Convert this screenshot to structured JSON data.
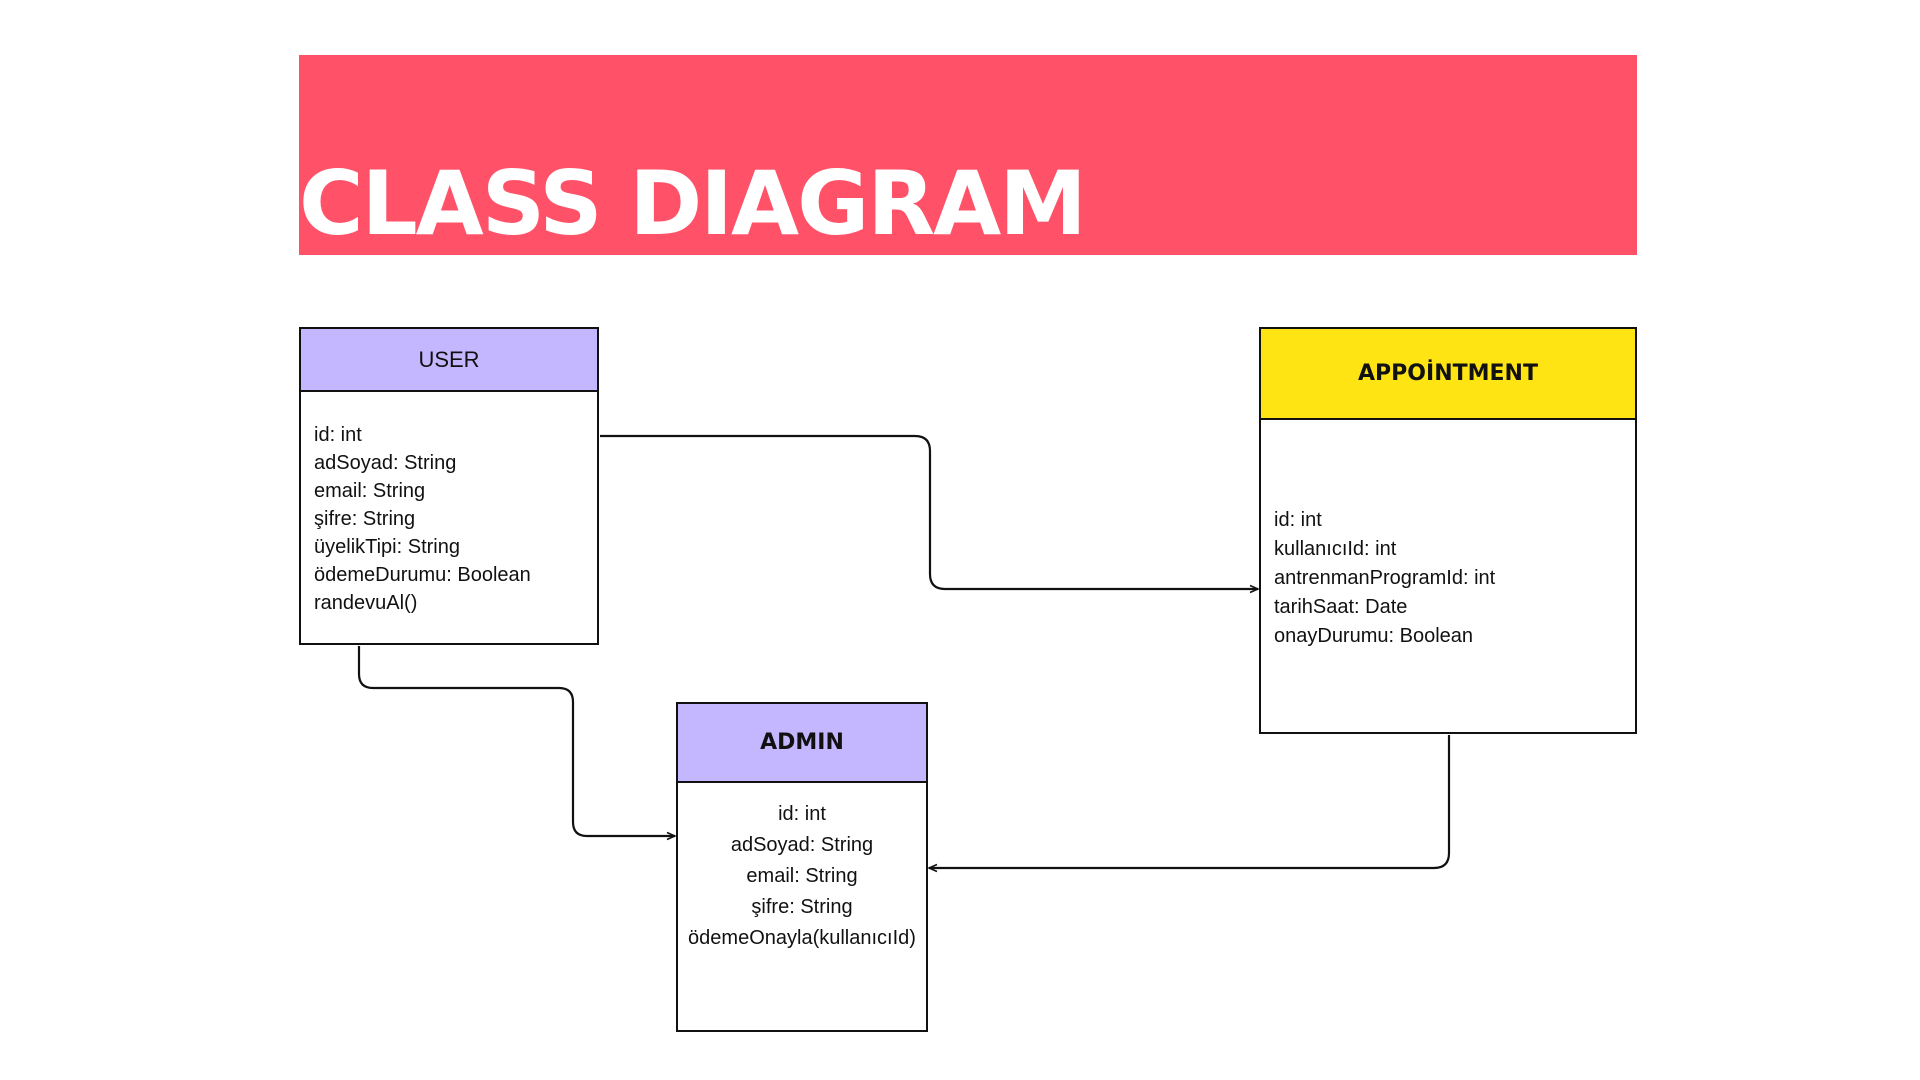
{
  "title": "CLASS DIAGRAM",
  "colors": {
    "banner": "#ff5269",
    "user_header": "#c4b7ff",
    "admin_header": "#c4b7ff",
    "appointment_header": "#ffe414",
    "border": "#111111"
  },
  "classes": {
    "user": {
      "name": "USER",
      "members": [
        "id: int",
        "adSoyad: String",
        "email: String",
        "şifre: String",
        "üyelikTipi: String",
        "ödemeDurumu: Boolean",
        "randevuAl()"
      ]
    },
    "appointment": {
      "name": "APPOİNTMENT",
      "members": [
        "id: int",
        "kullanıcıId: int",
        "antrenmanProgramId: int",
        "tarihSaat: Date",
        "onayDurumu: Boolean"
      ]
    },
    "admin": {
      "name": "ADMIN",
      "members": [
        "id: int",
        "adSoyad: String",
        "email: String",
        "şifre: String",
        "ödemeOnayla(kullanıcıId)"
      ]
    }
  },
  "connections": [
    {
      "from": "USER",
      "to": "APPOİNTMENT"
    },
    {
      "from": "USER",
      "to": "ADMIN"
    },
    {
      "from": "APPOİNTMENT",
      "to": "ADMIN"
    }
  ]
}
